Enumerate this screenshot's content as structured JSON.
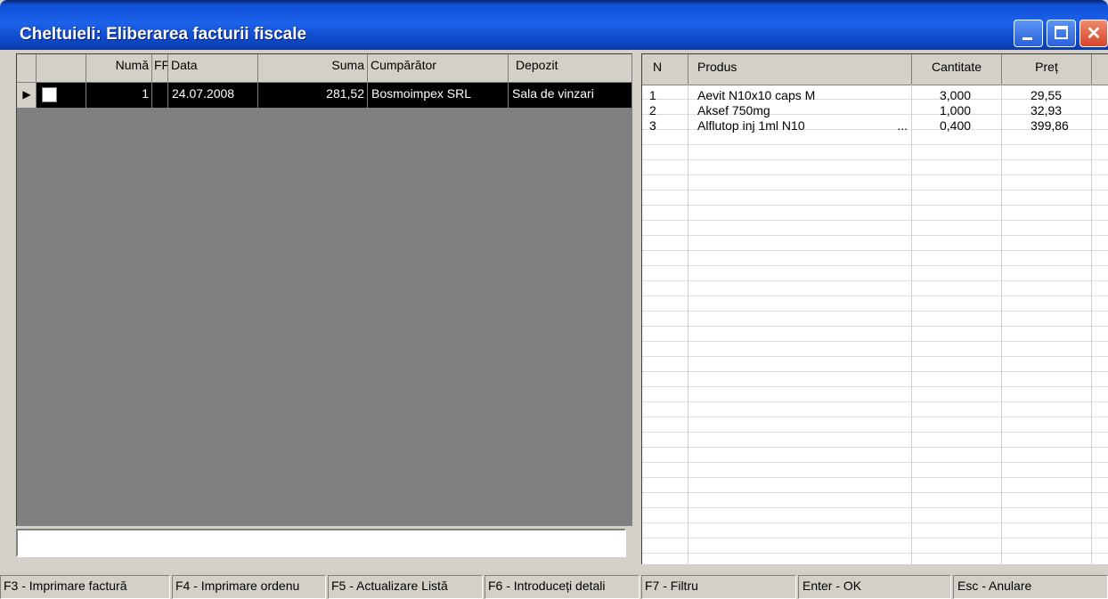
{
  "window": {
    "title": "Cheltuieli: Eliberarea facturii fiscale",
    "title_color": "#1c62e8"
  },
  "left_grid": {
    "columns": [
      "",
      "Numă",
      "FF",
      "Data",
      "Suma",
      "Cumpărător",
      "Depozit"
    ],
    "rows": [
      {
        "numar": "1",
        "ff": "",
        "data": "24.07.2008",
        "suma": "281,52",
        "cumparator": "Bosmoimpex SRL",
        "depozit": "Sala de vinzari",
        "checked": false
      }
    ]
  },
  "memo": {
    "value": ""
  },
  "right_grid": {
    "columns": [
      "N",
      "Produs",
      "Cantitate",
      "Preț"
    ],
    "rows": [
      {
        "n": "1",
        "produs": "Aevit N10x10 caps M",
        "extra": "",
        "cantitate": "3,000",
        "pret": "29,55"
      },
      {
        "n": "2",
        "produs": "Aksef 750mg",
        "extra": "",
        "cantitate": "1,000",
        "pret": "32,93"
      },
      {
        "n": "3",
        "produs": "Alflutop inj 1ml N10",
        "extra": "...",
        "cantitate": "0,400",
        "pret": "399,86"
      }
    ]
  },
  "statusbar": [
    "F3 - Imprimare factură",
    "F4 - Imprimare ordenu",
    "F5 - Actualizare Listă",
    "F6 - Introduceți detali",
    "F7 - Filtru",
    "Enter - OK",
    "Esc - Anulare"
  ]
}
